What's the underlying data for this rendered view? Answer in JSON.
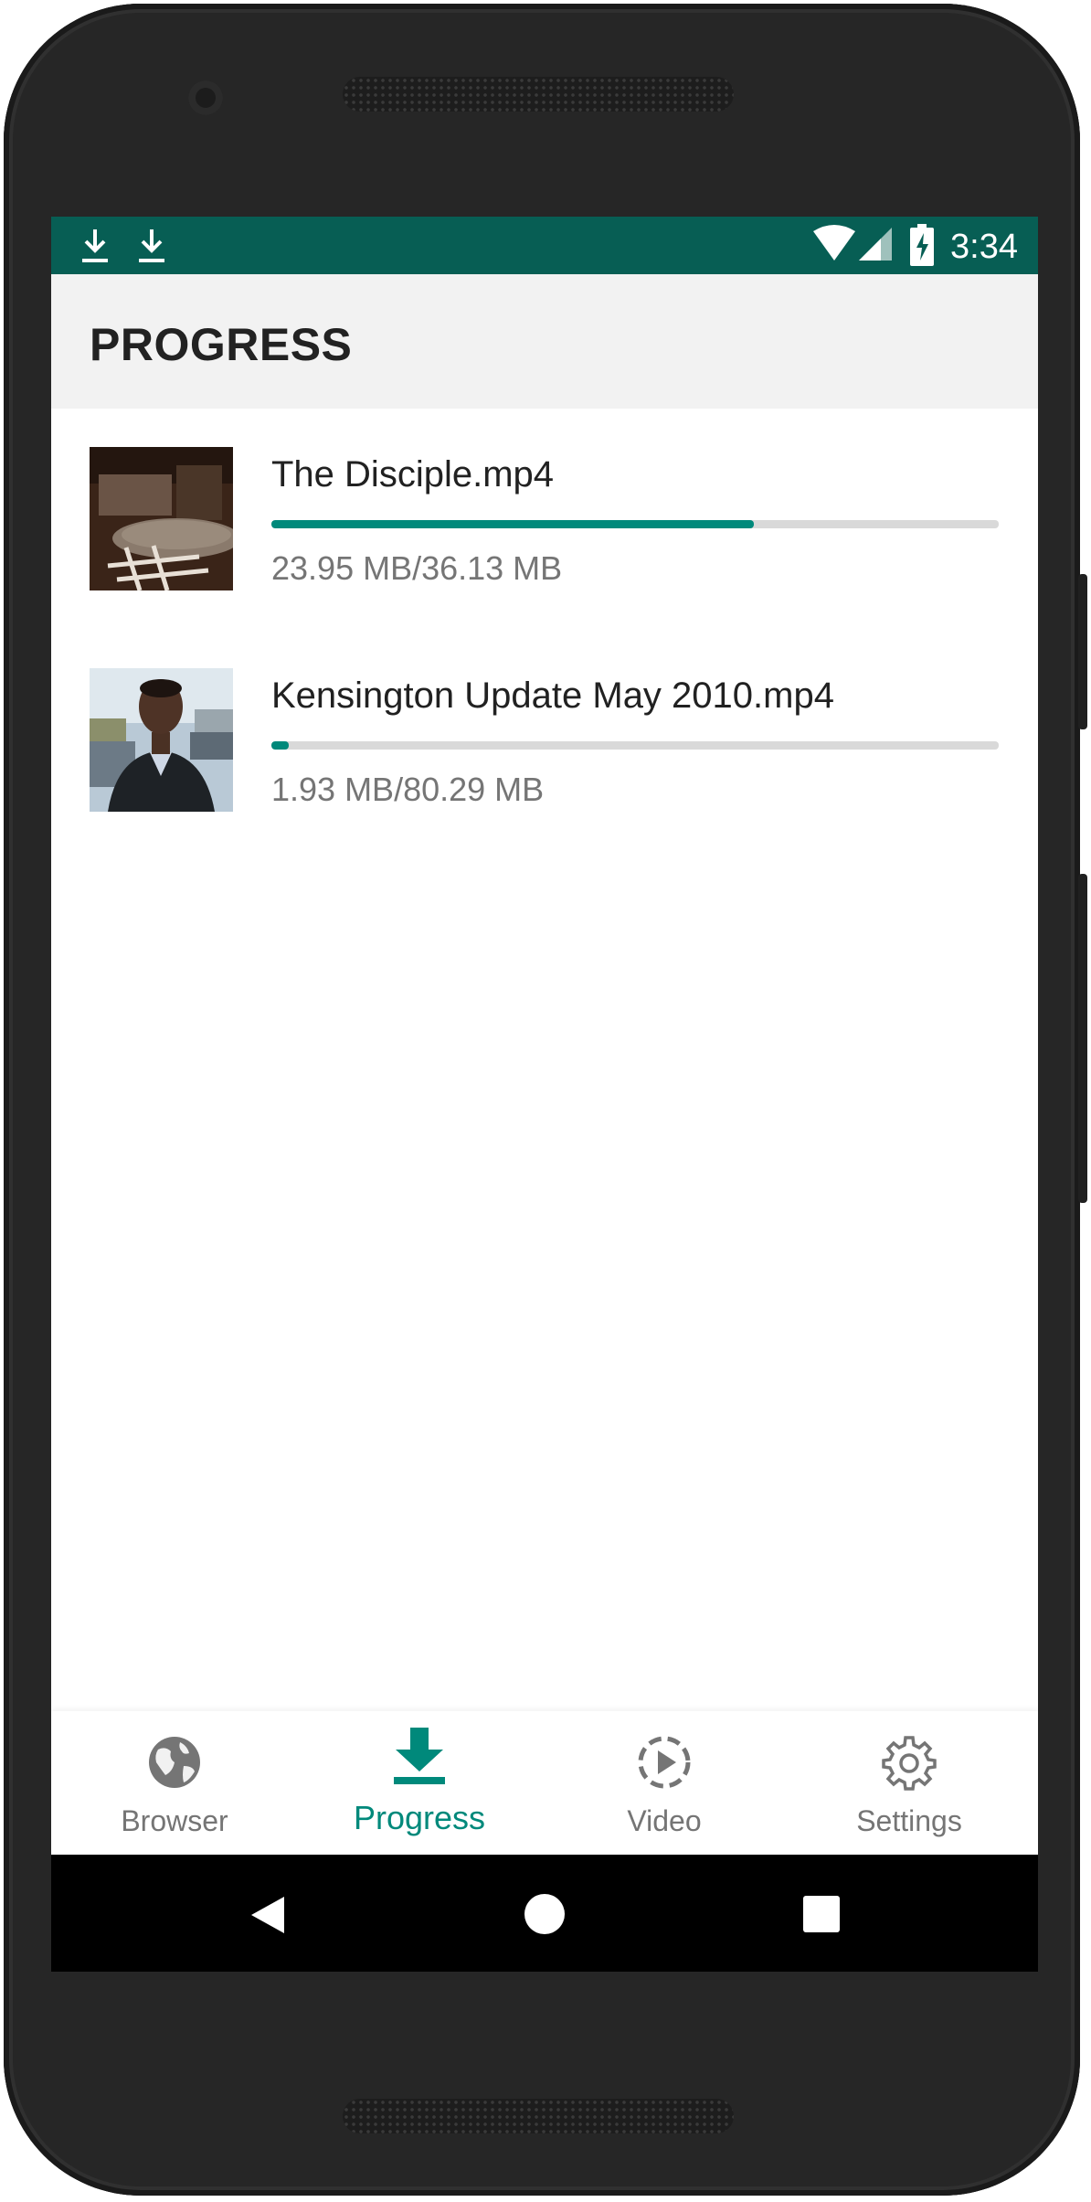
{
  "status_bar": {
    "time": "3:34",
    "left_icons": [
      "download-icon",
      "download-icon"
    ],
    "right_icons": [
      "wifi-icon",
      "signal-icon",
      "battery-charging-icon"
    ],
    "background_color": "#075e54"
  },
  "app_bar": {
    "title": "PROGRESS"
  },
  "downloads": [
    {
      "name": "The Disciple.mp4",
      "size_text": "23.95 MB/36.13 MB",
      "progress": 0.663
    },
    {
      "name": "Kensington Update May 2010.mp4",
      "size_text": "1.93 MB/80.29 MB",
      "progress": 0.024
    }
  ],
  "bottom_nav": {
    "items": [
      {
        "label": "Browser",
        "icon": "globe-icon",
        "active": false
      },
      {
        "label": "Progress",
        "icon": "download-icon",
        "active": true
      },
      {
        "label": "Video",
        "icon": "play-circle-icon",
        "active": false
      },
      {
        "label": "Settings",
        "icon": "gear-icon",
        "active": false
      }
    ]
  },
  "system_nav": {
    "icons": [
      "back-icon",
      "home-icon",
      "recents-icon"
    ]
  },
  "colors": {
    "accent": "#00897b",
    "status_bar": "#075e54",
    "track": "#d9d9d9"
  }
}
